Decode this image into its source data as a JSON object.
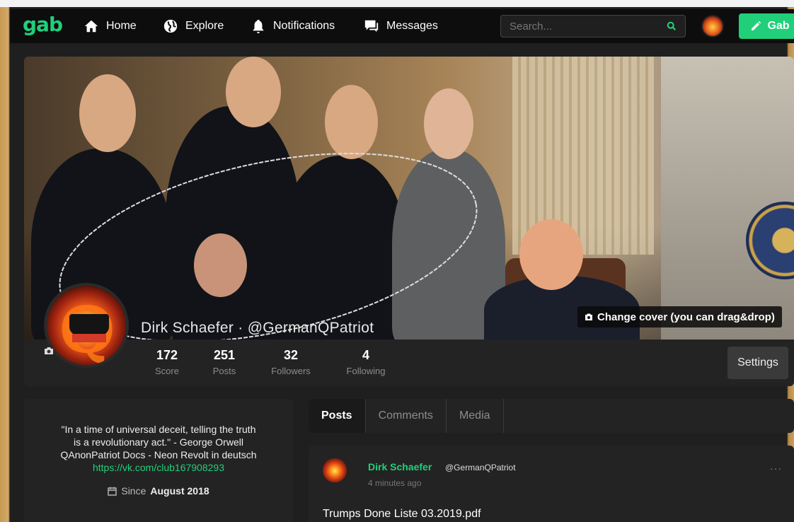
{
  "navbar": {
    "logo": "gab",
    "items": [
      {
        "label": "Home",
        "icon": "home-icon"
      },
      {
        "label": "Explore",
        "icon": "globe-icon"
      },
      {
        "label": "Notifications",
        "icon": "bell-icon"
      },
      {
        "label": "Messages",
        "icon": "chat-icon"
      }
    ],
    "search_placeholder": "Search...",
    "compose_label": "Gab"
  },
  "cover": {
    "change_cover_label": "Change cover (you can drag&drop)"
  },
  "profile": {
    "display_name": "Dirk Schaefer",
    "separator": " · ",
    "handle": "@GermanQPatriot",
    "stats": [
      {
        "value": "172",
        "label": "Score"
      },
      {
        "value": "251",
        "label": "Posts"
      },
      {
        "value": "32",
        "label": "Followers"
      },
      {
        "value": "4",
        "label": "Following"
      }
    ],
    "settings_label": "Settings"
  },
  "bio": {
    "quote_line1": "\"In a time of universal deceit, telling the truth",
    "quote_line2": "is a revolutionary act.\" - George Orwell",
    "line3": "QAnonPatriot Docs - Neon Revolt in deutsch",
    "link": "https://vk.com/club167908293",
    "since_prefix": "Since",
    "since_date": "August 2018"
  },
  "tabs": [
    {
      "label": "Posts",
      "active": true
    },
    {
      "label": "Comments",
      "active": false
    },
    {
      "label": "Media",
      "active": false
    }
  ],
  "post": {
    "author": "Dirk Schaefer",
    "handle": "@GermanQPatriot",
    "time": "4 minutes ago",
    "more": "···",
    "text": "Trumps Done Liste 03.2019.pdf"
  },
  "colors": {
    "accent": "#21cf7a",
    "nav_bg": "#0d0d0d",
    "card_bg": "#232323"
  }
}
